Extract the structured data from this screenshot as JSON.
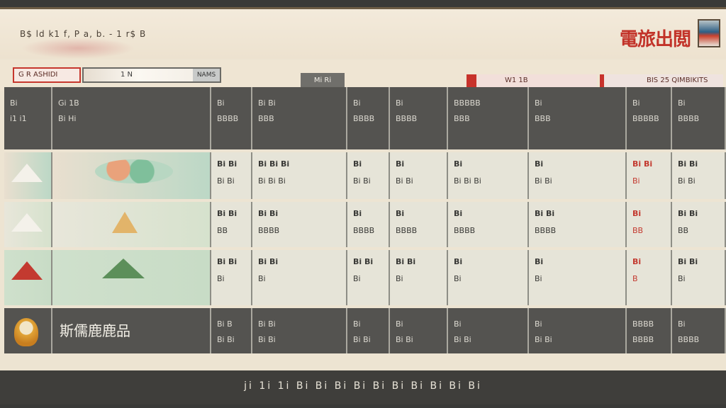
{
  "header": {
    "left_text": "B$ ld k1 f, P a, b. - 1 r$ B",
    "brand": "電旅出閲"
  },
  "toolbar": {
    "search_label": "G R ASHIDI",
    "search_value": "1 N",
    "search_go": "NAMS",
    "mid_button": "Mi Ri",
    "filter_1": "W1 1B",
    "filter_2": "BIS 25 QIMBIKITS"
  },
  "columns": [
    "",
    "",
    "",
    "",
    "",
    "",
    "",
    "",
    "",
    ""
  ],
  "rows": [
    {
      "kind": "header",
      "cells": [
        [
          "Bi",
          "i1 i1"
        ],
        [
          "Gi 1B",
          "Bi Hi"
        ],
        [
          "Bi",
          "BBBB"
        ],
        [
          "Bi Bi",
          "BBB"
        ],
        [
          "Bi",
          "BBBB"
        ],
        [
          "Bi",
          "BBBB"
        ],
        [
          "BBBBB",
          "BBB"
        ],
        [
          "Bi",
          "BBB"
        ],
        [
          "Bi",
          "BBBBB"
        ],
        [
          "Bi",
          "BBBB"
        ]
      ]
    },
    {
      "kind": "light",
      "cells": [
        [
          "",
          ""
        ],
        [
          "",
          ""
        ],
        [
          "Bi Bi",
          "Bi Bi"
        ],
        [
          "Bi Bi Bi",
          "Bi Bi Bi"
        ],
        [
          "Bi",
          "Bi Bi"
        ],
        [
          "Bi",
          "Bi Bi"
        ],
        [
          "Bi",
          "Bi Bi Bi"
        ],
        [
          "Bi",
          "Bi Bi"
        ],
        [
          "Bi Bi",
          "Bi"
        ],
        [
          "Bi Bi",
          "Bi Bi"
        ]
      ]
    },
    {
      "kind": "light",
      "cells": [
        [
          "",
          ""
        ],
        [
          "",
          ""
        ],
        [
          "Bi Bi",
          "BB"
        ],
        [
          "Bi Bi",
          "BBBB"
        ],
        [
          "Bi",
          "BBBB"
        ],
        [
          "Bi",
          "BBBB"
        ],
        [
          "Bi",
          "BBBB"
        ],
        [
          "Bi Bi",
          "BBBB"
        ],
        [
          "Bi",
          "BB"
        ],
        [
          "Bi Bi",
          "BB"
        ]
      ]
    },
    {
      "kind": "light",
      "cells": [
        [
          "",
          ""
        ],
        [
          "",
          ""
        ],
        [
          "Bi Bi",
          "Bi"
        ],
        [
          "Bi Bi",
          "Bi"
        ],
        [
          "Bi Bi",
          "Bi"
        ],
        [
          "Bi Bi",
          "Bi"
        ],
        [
          "Bi",
          "Bi"
        ],
        [
          "Bi",
          "Bi"
        ],
        [
          "Bi",
          "B"
        ],
        [
          "Bi Bi",
          "Bi"
        ]
      ]
    },
    {
      "kind": "footer",
      "title": "斯儒鹿鹿品",
      "cells": [
        [
          "",
          ""
        ],
        [
          "",
          ""
        ],
        [
          "Bi B",
          "Bi Bi"
        ],
        [
          "Bi Bi",
          "Bi Bi"
        ],
        [
          "Bi",
          "Bi Bi"
        ],
        [
          "Bi",
          "Bi Bi"
        ],
        [
          "Bi",
          "Bi Bi"
        ],
        [
          "Bi",
          "Bi Bi"
        ],
        [
          "BBBB",
          "BBBB"
        ],
        [
          "Bi",
          "BBBB"
        ]
      ]
    }
  ],
  "footer_text": "ji 1i 1i Bi Bi Bi Bi Bi Bi Bi Bi Bi Bi",
  "colors": {
    "accent": "#c7322b",
    "dark": "#545350",
    "paper": "#ede4d2"
  }
}
